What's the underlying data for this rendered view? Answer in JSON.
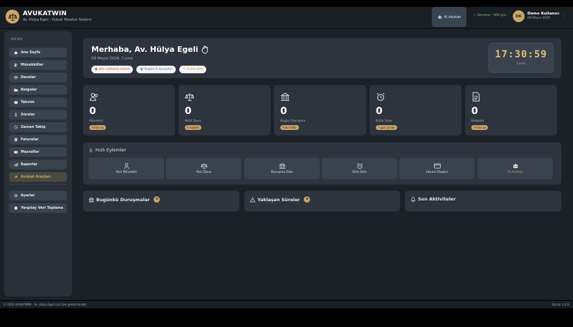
{
  "header": {
    "app_name": "AVUKATWIN",
    "subtitle": "Av. Hülya Egeli - Hukuk Yönetim Sistemi",
    "ai_button": "AI Asistan",
    "trial": "Deneme - 964 gün",
    "user_initials": "DK",
    "user_name": "Demo Kullanıcı",
    "user_date": "08 Mayıs 2026"
  },
  "sidebar": {
    "menu_title": "MENÜ",
    "items": [
      {
        "label": "Ana Sayfa",
        "icon": "home-icon"
      },
      {
        "label": "Müvekkiller",
        "icon": "users-icon"
      },
      {
        "label": "Davalar",
        "icon": "scales-icon"
      },
      {
        "label": "Belgeler",
        "icon": "folder-icon"
      },
      {
        "label": "Takvim",
        "icon": "calendar-icon"
      },
      {
        "label": "Süreler",
        "icon": "hourglass-icon"
      },
      {
        "label": "Zaman Takip",
        "icon": "clock-icon"
      },
      {
        "label": "Faturalar",
        "icon": "invoice-icon"
      },
      {
        "label": "Masraflar",
        "icon": "wallet-icon"
      },
      {
        "label": "Raporlar",
        "icon": "report-icon"
      },
      {
        "label": "Avukat Araçları",
        "icon": "tools-icon"
      }
    ],
    "bottom_items": [
      {
        "label": "Ayarlar",
        "icon": "gear-icon"
      },
      {
        "label": "Yargıtay Veri Toplama",
        "icon": "database-icon"
      }
    ]
  },
  "welcome": {
    "greeting": "Merhaba, Av. Hülya Egeli",
    "date": "08 Mayıs 2026, Cuma",
    "chips": [
      "Veri yükleme hatası",
      "Bugün 0 duruşma",
      "0 acil süre"
    ],
    "clock_time": "17:30:59",
    "clock_day": "Cuma"
  },
  "stats": [
    {
      "value": "0",
      "label": "Müvekkil",
      "badge": "+0 bu ay"
    },
    {
      "value": "0",
      "label": "Aktif Dava",
      "badge": "0 toplam"
    },
    {
      "value": "0",
      "label": "Bugün Duruşma",
      "badge": "0 bu hafta"
    },
    {
      "value": "0",
      "label": "Kritik Süre",
      "badge": "7 gün içinde"
    },
    {
      "value": "0",
      "label": "Belgeler",
      "badge": "+0 bu ay"
    }
  ],
  "quick_actions": {
    "title": "Hızlı Eylemler",
    "items": [
      "Yeni Müvekkil",
      "Yeni Dava",
      "Duruşma Ekle",
      "Süre Ekle",
      "Fatura Oluştur",
      "AI Asistan"
    ]
  },
  "panels": [
    {
      "title": "Bugünkü Duruşmalar",
      "count": "0"
    },
    {
      "title": "Yaklaşan Süreler",
      "count": "0"
    },
    {
      "title": "Son Aktiviteler"
    }
  ],
  "footer": {
    "copyright": "© 2026 AVUKATWIN - Av. Hülya Egeli için özel geliştirilmiştir",
    "version": "Sürüm 1.0.0"
  },
  "colors": {
    "accent_gold": "#c9a76a",
    "clock_gold": "#e2bf7a",
    "background": "#1c2027",
    "card": "#2e343d"
  }
}
